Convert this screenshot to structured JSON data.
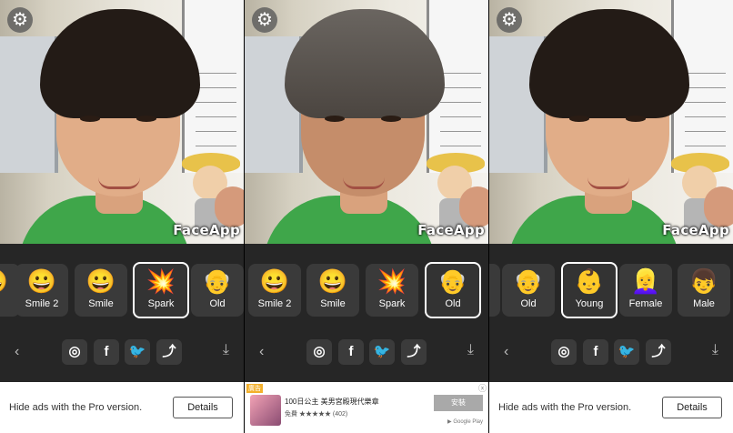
{
  "brand": {
    "watermark": "FaceApp"
  },
  "screens": [
    {
      "filters": [
        {
          "emoji": "😀",
          "label": ""
        },
        {
          "emoji": "😀",
          "label": "Smile 2"
        },
        {
          "emoji": "😀",
          "label": "Smile"
        },
        {
          "emoji": "💥",
          "label": "Spark"
        },
        {
          "emoji": "👴",
          "label": "Old"
        }
      ],
      "ad": {
        "text": "Hide ads with the Pro version.",
        "button": "Details"
      }
    },
    {
      "filters": [
        {
          "emoji": "😀",
          "label": "Smile 2"
        },
        {
          "emoji": "😀",
          "label": "Smile"
        },
        {
          "emoji": "💥",
          "label": "Spark"
        },
        {
          "emoji": "👴",
          "label": "Old"
        }
      ],
      "ad": {
        "tag": "廣告",
        "title": "100日公主 美男宮殿現代樂章",
        "sub": "免費 ★★★★★ (402)",
        "install": "安裝",
        "store": "▶ Google Play",
        "close": "ⓧ"
      }
    },
    {
      "filters": [
        {
          "emoji": "👴",
          "label": ""
        },
        {
          "emoji": "👴",
          "label": "Old"
        },
        {
          "emoji": "👶",
          "label": "Young"
        },
        {
          "emoji": "👱‍♀️",
          "label": "Female"
        },
        {
          "emoji": "👦",
          "label": "Male"
        }
      ],
      "ad": {
        "text": "Hide ads with the Pro version.",
        "button": "Details"
      }
    }
  ],
  "share": {
    "back": "‹",
    "instagram": "◎",
    "facebook": "f",
    "twitter": "🐦",
    "share": "⤴",
    "download": "⤓"
  },
  "settings_icon": "⚙"
}
